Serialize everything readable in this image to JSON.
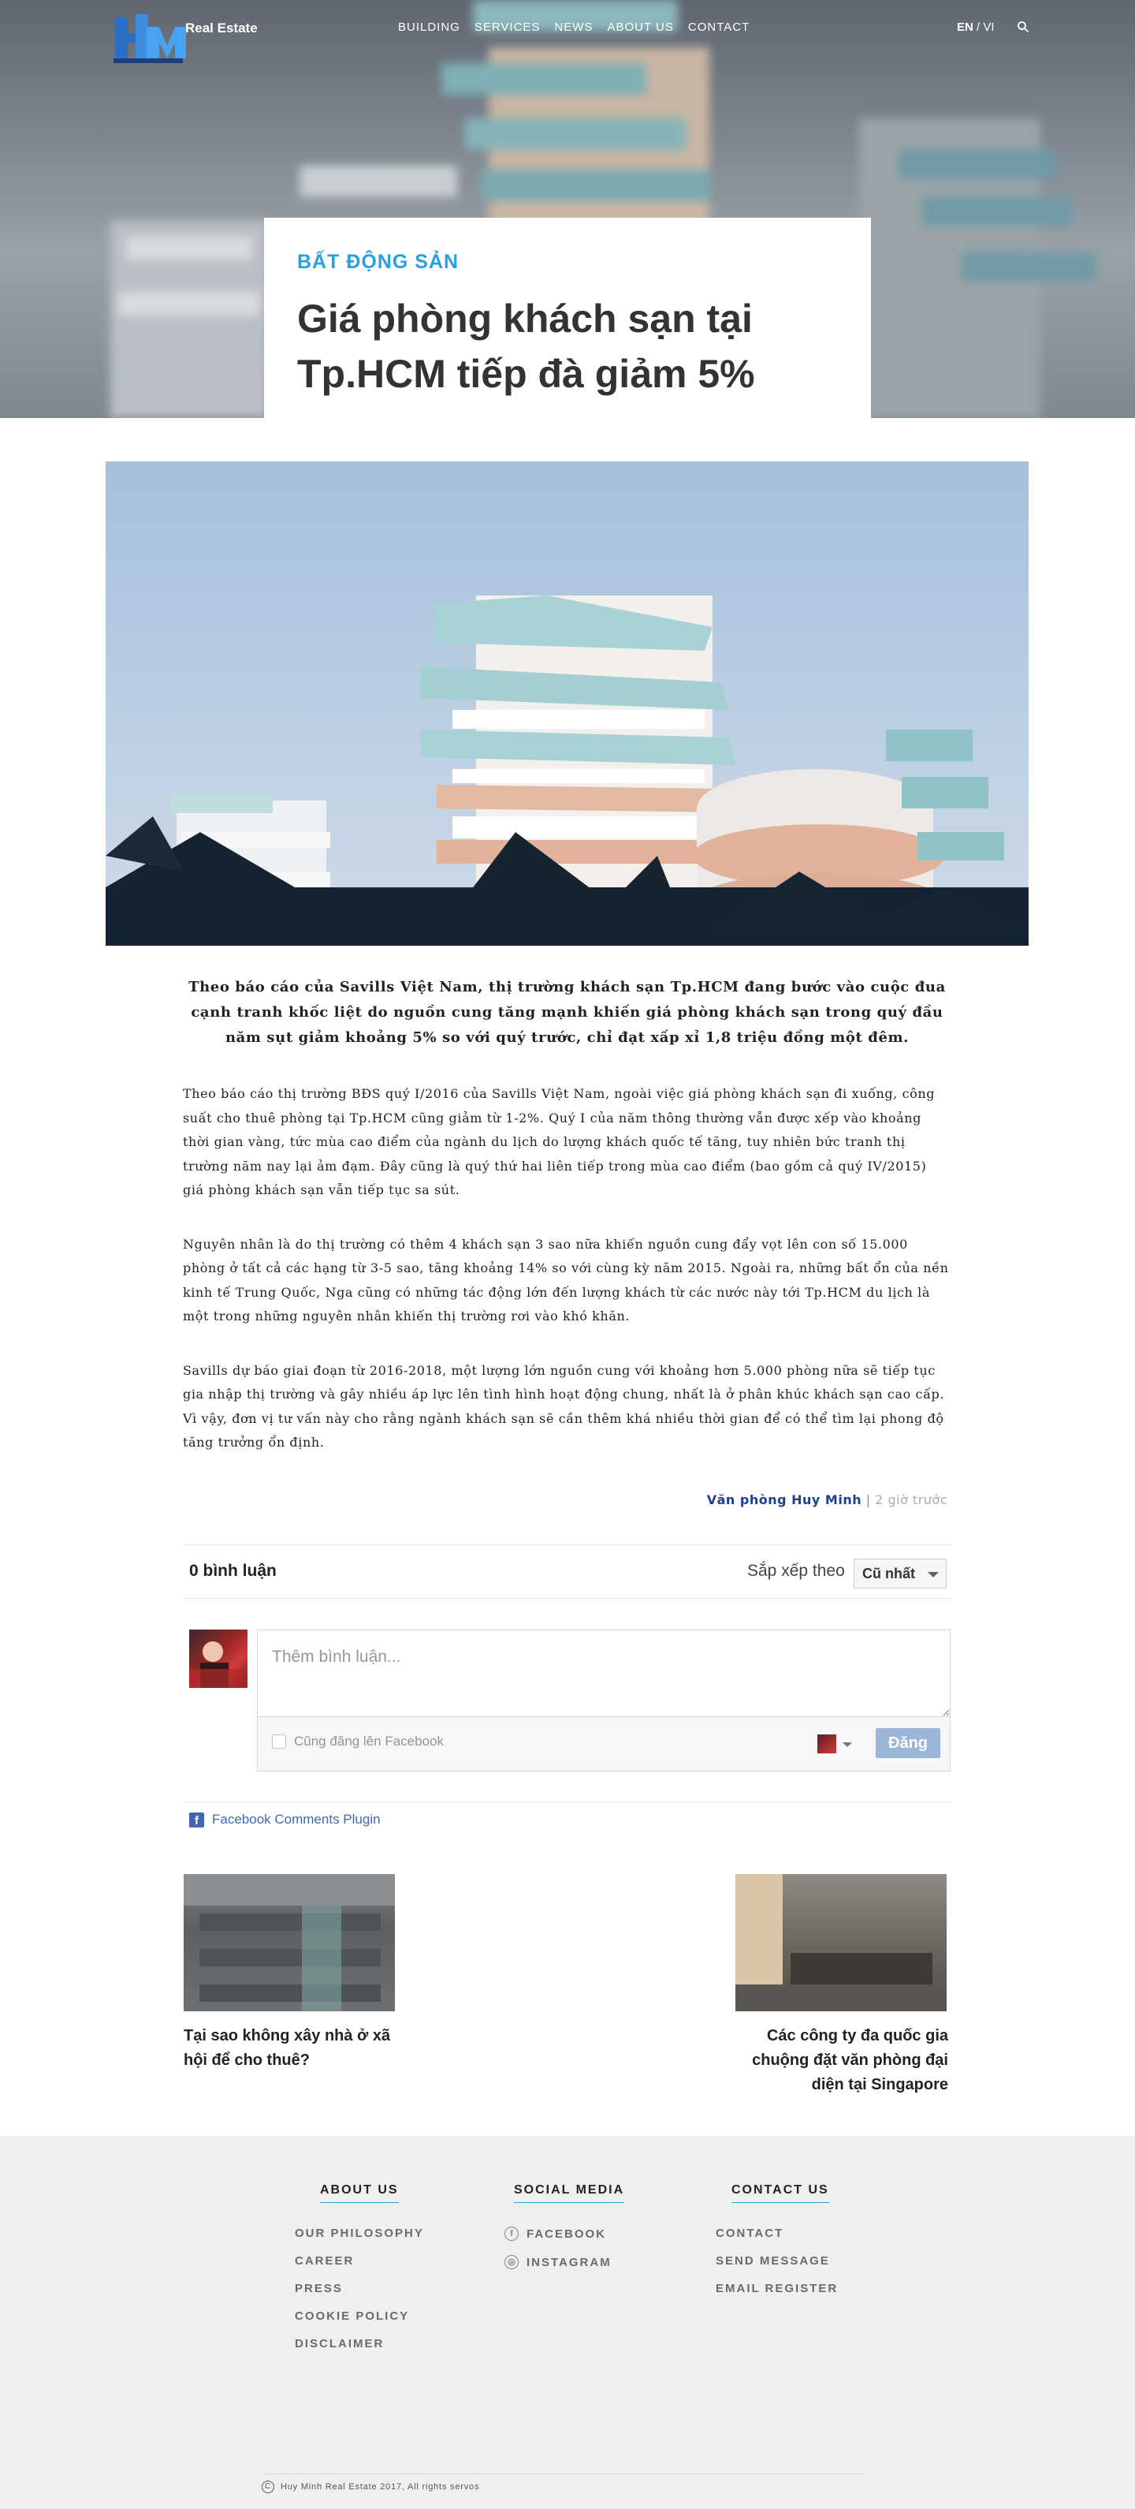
{
  "header": {
    "logo_text": "Real Estate",
    "nav": [
      "BUILDING",
      "SERVICES",
      "NEWS",
      "ABOUT US",
      "CONTACT"
    ],
    "lang_active": "EN",
    "lang_sep": " / ",
    "lang_other": "VI",
    "search_icon": "search-icon"
  },
  "hero": {
    "category": "BẤT ĐỘNG SẢN",
    "title": "Giá phòng khách sạn tại Tp.HCM tiếp đà giảm 5%"
  },
  "article": {
    "lead": "Theo báo cáo của Savills Việt Nam, thị trường khách sạn Tp.HCM đang bước vào cuộc đua cạnh tranh khốc liệt do nguồn cung tăng mạnh khiến giá phòng khách sạn trong quý đầu năm sụt giảm khoảng 5% so với quý trước, chỉ đạt xấp xỉ 1,8 triệu đồng một đêm.",
    "paragraphs": [
      "Theo báo cáo thị trường BĐS quý I/2016 của Savills Việt Nam, ngoài việc giá phòng khách sạn đi xuống, công suất cho thuê phòng tại Tp.HCM cũng giảm từ 1-2%. Quý I của năm thông thường vẫn được xếp vào khoảng thời gian vàng, tức mùa cao điểm của ngành du lịch do lượng khách quốc tế tăng, tuy nhiên bức tranh thị trường năm nay lại ảm đạm. Đây cũng là quý thứ hai liên tiếp trong mùa cao điểm (bao gồm cả quý IV/2015) giá phòng khách sạn vẫn tiếp tục sa sút.",
      "Nguyên nhân là do thị trường có thêm 4 khách sạn 3 sao nữa khiến nguồn cung đẩy vọt lên con số 15.000 phòng ở tất cả các hạng từ 3-5 sao, tăng khoảng 14% so với cùng kỳ năm 2015. Ngoài ra, những bất ổn của nền kinh tế Trung Quốc, Nga cũng có những tác động lớn đến lượng khách từ các nước này tới Tp.HCM du lịch là một trong những nguyên nhân khiến thị trường rơi vào khó khăn.",
      "Savills dự báo giai đoạn từ 2016-2018, một lượng lớn nguồn cung với khoảng hơn 5.000 phòng nữa sẽ tiếp tục gia nhập thị trường và gây nhiều áp lực lên tình hình hoạt động chung, nhất là ở phân khúc khách sạn cao cấp. Vì vậy, đơn vị tư vấn này cho rằng ngành khách sạn sẽ cần thêm khá nhiều thời gian để có thể tìm lại phong độ tăng trưởng ổn định."
    ],
    "author": "Văn phòng Huy Minh",
    "separator": " | ",
    "time": "2 giờ trước"
  },
  "comments": {
    "count": "0 bình luận",
    "sort_label": "Sắp xếp theo",
    "sort_value": "Cũ nhất",
    "placeholder": "Thêm bình luận...",
    "also_post": "Cũng đăng lên Facebook",
    "post_button": "Đăng",
    "plugin": "Facebook Comments Plugin"
  },
  "related": {
    "prev_title": "Tại sao không xây nhà ở xã hội để cho thuê?",
    "next_title": "Các công ty đa quốc gia chuộng đặt văn phòng đại diện tại Singapore"
  },
  "footer": {
    "about": {
      "heading": "ABOUT US",
      "links": [
        "OUR PHILOSOPHY",
        "CAREER",
        "PRESS",
        "COOKIE POLICY",
        "DISCLAIMER"
      ]
    },
    "social": {
      "heading": "SOCIAL MEDIA",
      "links": [
        "FACEBOOK",
        "INSTAGRAM"
      ]
    },
    "contact": {
      "heading": "CONTACT US",
      "links": [
        "CONTACT",
        "SEND MESSAGE",
        "EMAIL REGISTER"
      ]
    },
    "copyright": "Huy Minh Real Estate 2017, All rights servos",
    "copyright_symbol": "C"
  },
  "colors": {
    "accent": "#2a9fe0",
    "author": "#1f3f8f",
    "facebook": "#4267b2",
    "footer_bg": "#efeff1"
  }
}
